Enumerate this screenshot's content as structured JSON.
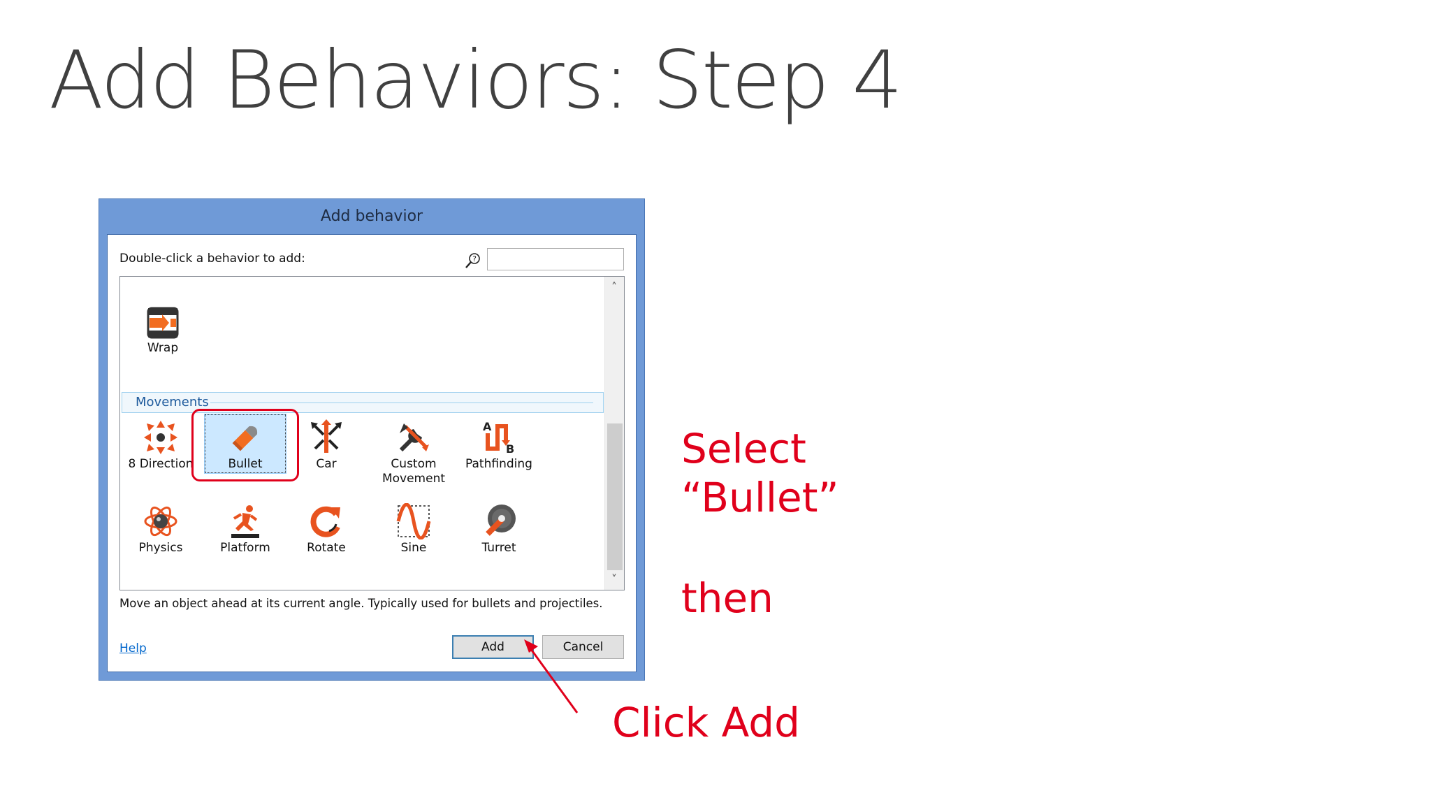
{
  "slide": {
    "title": "Add Behaviors: Step 4"
  },
  "dialog": {
    "title": "Add behavior",
    "instruction": "Double-click a behavior to add:",
    "search_placeholder": "",
    "list": {
      "top_items": [
        {
          "label": "Wrap",
          "icon": "wrap-icon"
        }
      ],
      "group_label": "Movements",
      "movement_items": [
        {
          "label": "8 Direction",
          "icon": "8-direction-icon"
        },
        {
          "label": "Bullet",
          "icon": "bullet-icon",
          "selected": true
        },
        {
          "label": "Car",
          "icon": "car-icon"
        },
        {
          "label": "Custom Movement",
          "icon": "custom-movement-icon"
        },
        {
          "label": "Pathfinding",
          "icon": "pathfinding-icon"
        },
        {
          "label": "Physics",
          "icon": "physics-icon"
        },
        {
          "label": "Platform",
          "icon": "platform-icon"
        },
        {
          "label": "Rotate",
          "icon": "rotate-icon"
        },
        {
          "label": "Sine",
          "icon": "sine-icon"
        },
        {
          "label": "Turret",
          "icon": "turret-icon"
        }
      ]
    },
    "description": "Move an object ahead at its current angle.  Typically used for bullets and projectiles.",
    "help_label": "Help",
    "add_label": "Add",
    "cancel_label": "Cancel",
    "colors": {
      "title_bar": "#6f9ad7",
      "selection": "#cce8ff",
      "group_header": "#1e5a9c"
    }
  },
  "annotations": {
    "select_line1": "Select",
    "select_line2": "“Bullet”",
    "then": "then",
    "click_add": "Click Add",
    "color": "#e0001b"
  }
}
